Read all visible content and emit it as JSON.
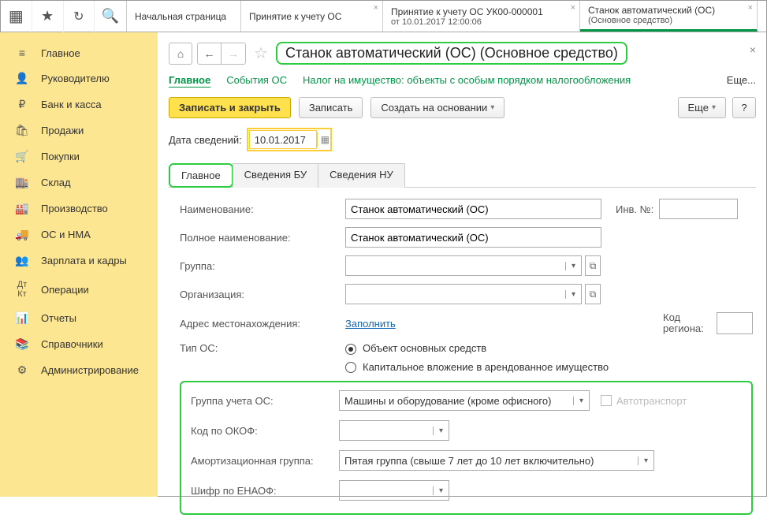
{
  "toolbar_icons": {
    "grid": "⠿",
    "star": "★",
    "clip": "⎘",
    "search": "🔍"
  },
  "tabs": [
    {
      "line1": "Начальная страница",
      "closable": false
    },
    {
      "line1": "Принятие к учету ОС",
      "closable": true
    },
    {
      "line1": "Принятие к учету ОС УК00-000001",
      "line2": "от 10.01.2017 12:00:06",
      "closable": true
    },
    {
      "line1": "Станок автоматический (ОС)",
      "line2": "(Основное средство)",
      "closable": true
    }
  ],
  "sidebar": [
    {
      "icon": "≡",
      "label": "Главное"
    },
    {
      "icon": "👤",
      "label": "Руководителю"
    },
    {
      "icon": "₽",
      "label": "Банк и касса"
    },
    {
      "icon": "🛍",
      "label": "Продажи"
    },
    {
      "icon": "🛒",
      "label": "Покупки"
    },
    {
      "icon": "🏢",
      "label": "Склад"
    },
    {
      "icon": "🏭",
      "label": "Производство"
    },
    {
      "icon": "🚚",
      "label": "ОС и НМА"
    },
    {
      "icon": "👥",
      "label": "Зарплата и кадры"
    },
    {
      "icon": "ᴬᵏ",
      "label": "Операции"
    },
    {
      "icon": "📊",
      "label": "Отчеты"
    },
    {
      "icon": "📚",
      "label": "Справочники"
    },
    {
      "icon": "⚙",
      "label": "Администрирование"
    }
  ],
  "header": {
    "title": "Станок автоматический (ОС) (Основное средство)"
  },
  "subnav": {
    "item1": "Главное",
    "item2": "События ОС",
    "item3": "Налог на имущество: объекты с особым порядком налогообложения",
    "more": "Еще..."
  },
  "actions": {
    "save_close": "Записать и закрыть",
    "save": "Записать",
    "create_base": "Создать на основании",
    "more": "Еще",
    "help": "?"
  },
  "date": {
    "label": "Дата сведений:",
    "value": "10.01.2017"
  },
  "mini_tabs": {
    "t1": "Главное",
    "t2": "Сведения БУ",
    "t3": "Сведения НУ"
  },
  "form": {
    "name_label": "Наименование:",
    "name_value": "Станок автоматический (ОС)",
    "inv_label": "Инв. №:",
    "inv_value": "",
    "fullname_label": "Полное наименование:",
    "fullname_value": "Станок автоматический (ОС)",
    "group_label": "Группа:",
    "group_value": "",
    "org_label": "Организация:",
    "org_value": "",
    "addr_label": "Адрес местонахождения:",
    "addr_link": "Заполнить",
    "region_label": "Код региона:",
    "region_value": "",
    "type_label": "Тип ОС:",
    "type_opt1": "Объект основных средств",
    "type_opt2": "Капитальное вложение в арендованное имущество"
  },
  "green": {
    "acct_group_label": "Группа учета ОС:",
    "acct_group_value": "Машины и оборудование (кроме офисного)",
    "auto_label": "Автотранспорт",
    "okof_label": "Код по ОКОФ:",
    "okof_value": "",
    "amort_label": "Амортизационная группа:",
    "amort_value": "Пятая группа (свыше 7 лет до 10 лет включительно)",
    "enaof_label": "Шифр по ЕНАОФ:",
    "enaof_value": ""
  }
}
